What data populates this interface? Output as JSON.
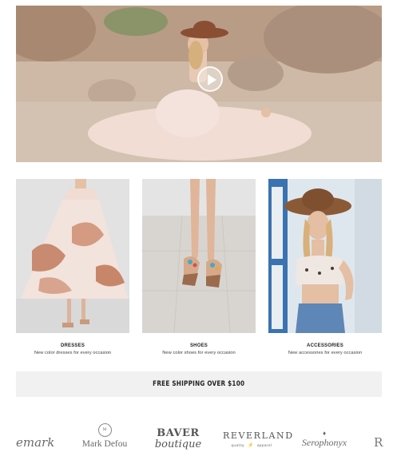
{
  "hero": {
    "play_icon": "play-icon"
  },
  "categories": [
    {
      "title": "DRESSES",
      "desc": "New color dresses for every occasion"
    },
    {
      "title": "SHOES",
      "desc": "New color shoes for every occasion"
    },
    {
      "title": "ACCESSORIES",
      "desc": "New accessories for every occasion"
    }
  ],
  "shipping": {
    "text": "FREE SHIPPING OVER $100"
  },
  "brands": {
    "b1": "emark",
    "b2_mark": "M",
    "b2": "Mark Defou",
    "b3_l1": "BAVER",
    "b3_l2": "boutique",
    "b4_l1": "REVERLAND",
    "b4_l2a": "quality",
    "b4_l2b": "apparel",
    "b5": "Serophonyx",
    "b6": "R"
  },
  "colors": {
    "banner_bg": "#f1f1f1",
    "text": "#222222"
  }
}
